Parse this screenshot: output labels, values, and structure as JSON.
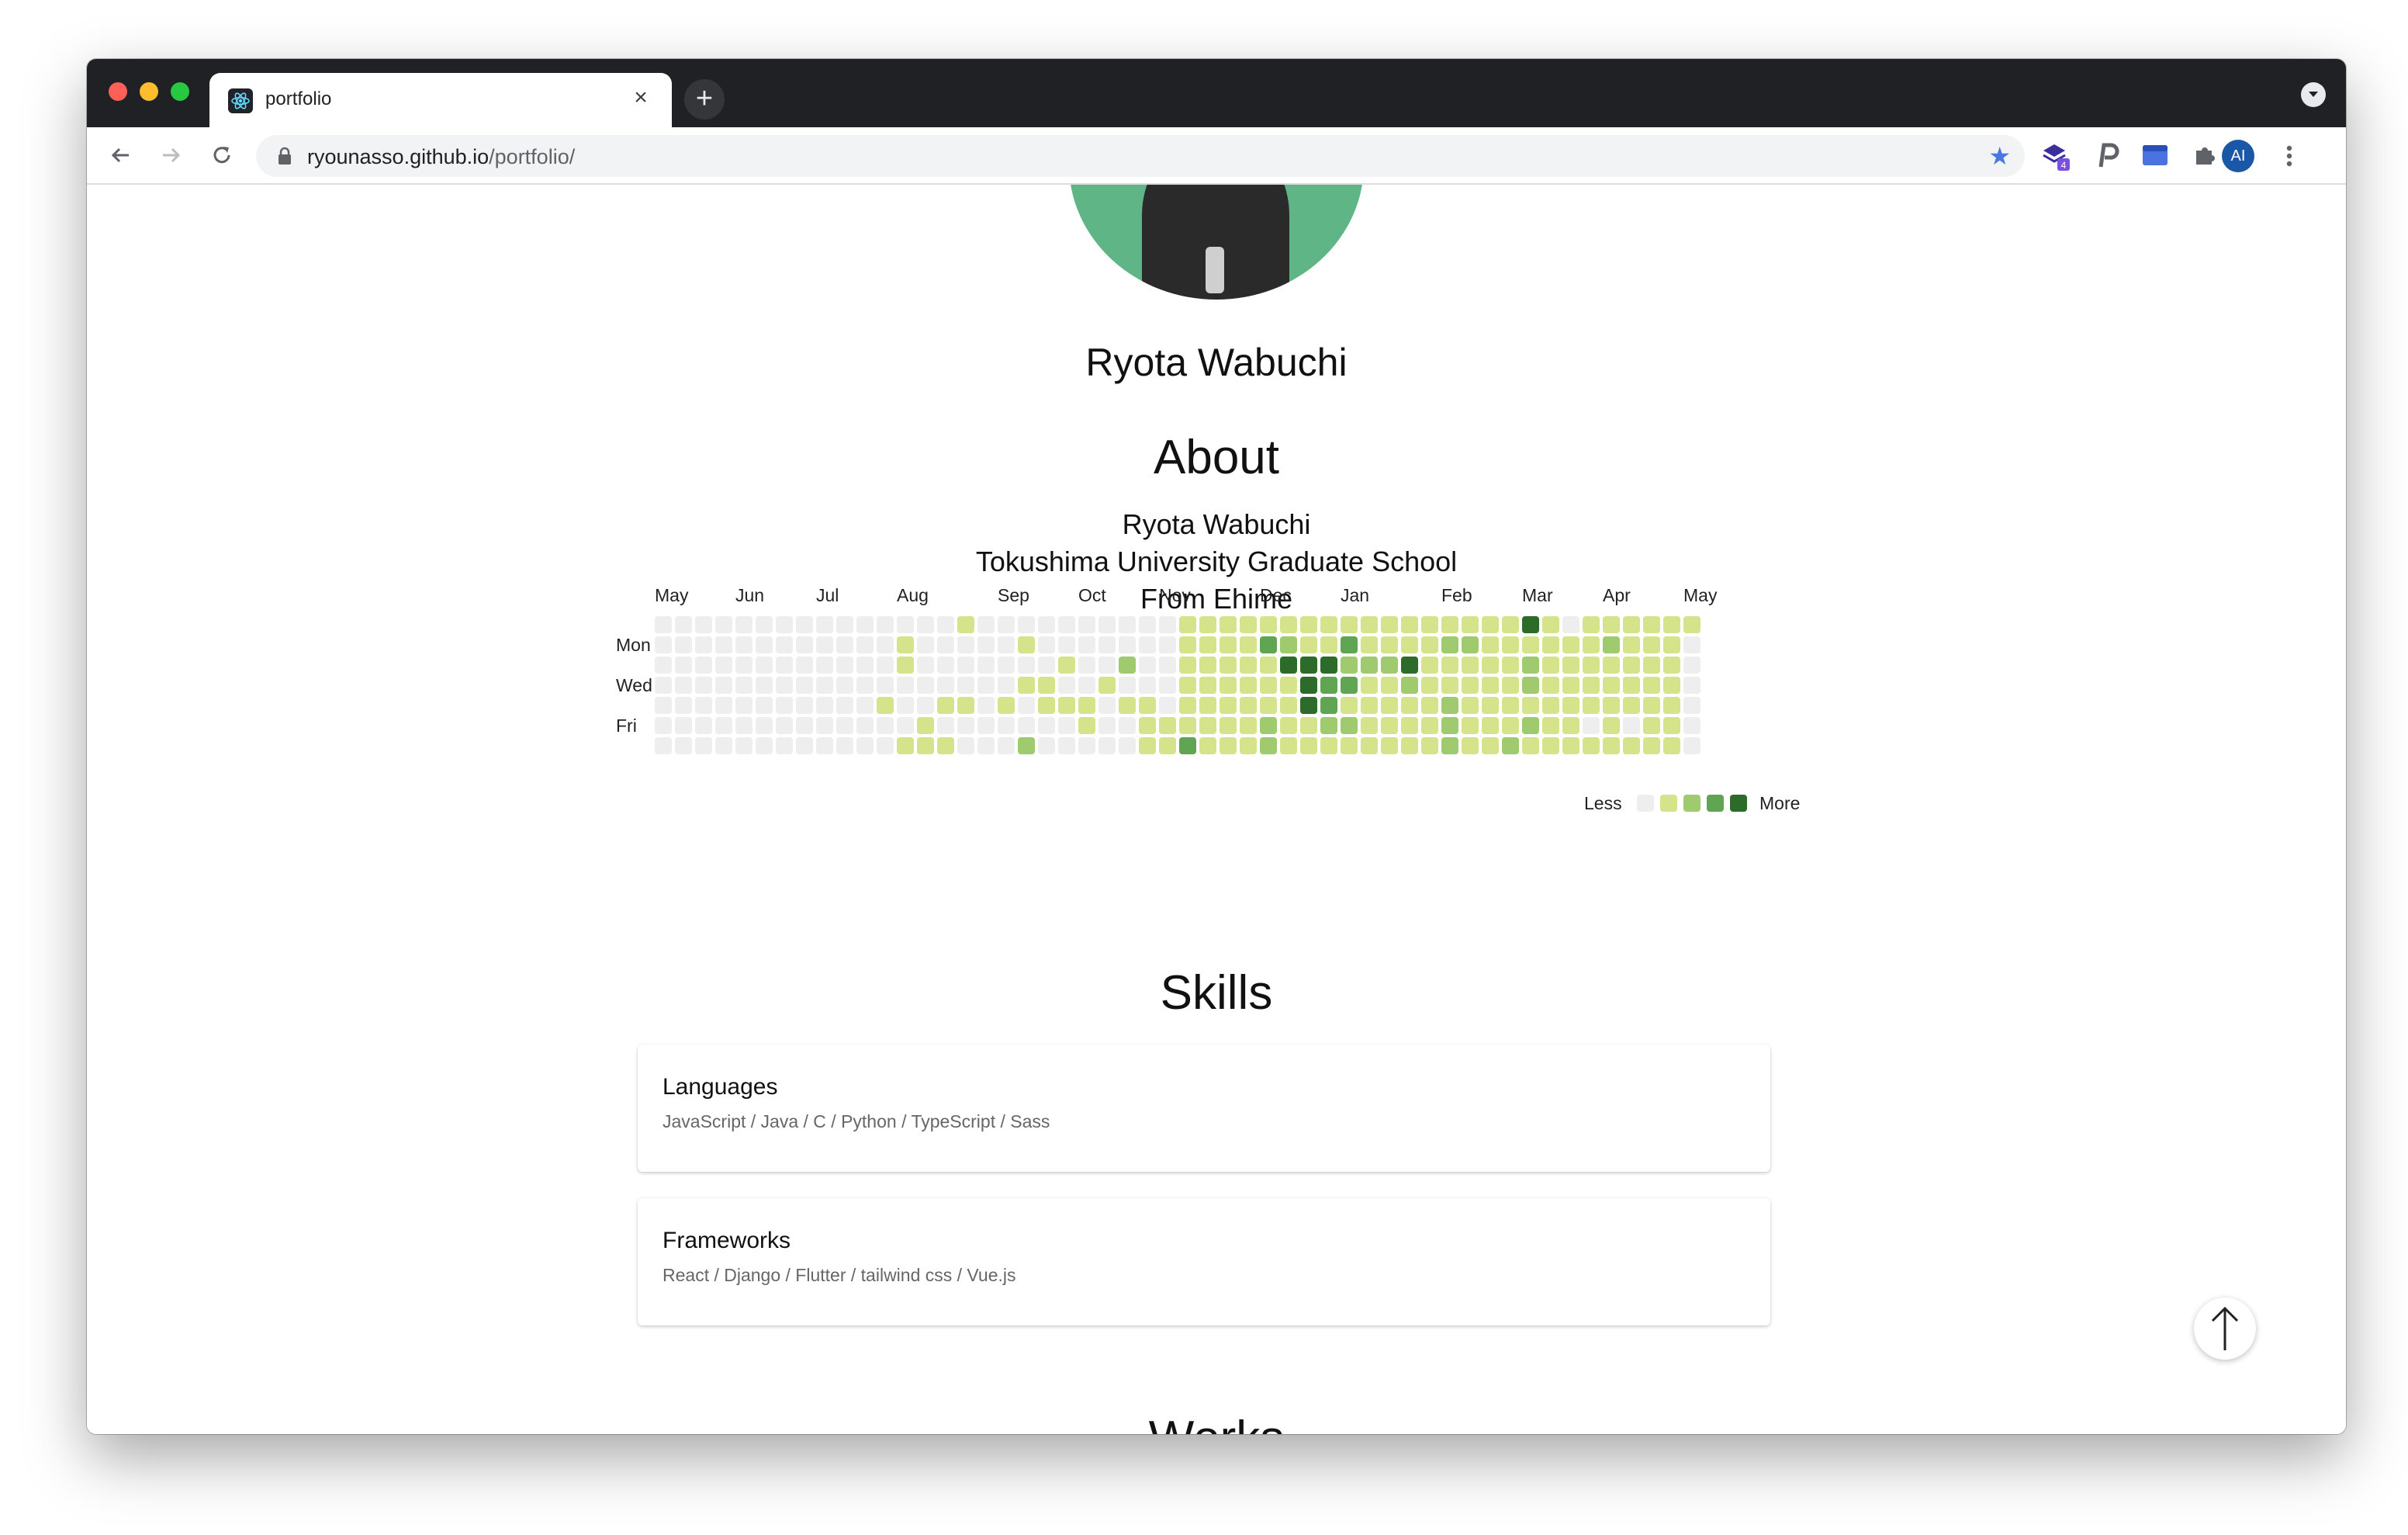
{
  "browser": {
    "tab_title": "portfolio",
    "url_host": "ryounasso.github.io",
    "url_path": "/portfolio/",
    "extension_badge": "4",
    "profile_initials": "AI"
  },
  "profile": {
    "name": "Ryota Wabuchi"
  },
  "about": {
    "title": "About",
    "lines": [
      "Ryota Wabuchi",
      "Tokushima University Graduate School",
      "From Ehime"
    ]
  },
  "contributions": {
    "months": [
      "May",
      "Jun",
      "Jul",
      "Aug",
      "Sep",
      "Oct",
      "Nov",
      "Dec",
      "Jan",
      "Feb",
      "Mar",
      "Apr",
      "May"
    ],
    "month_weeks": [
      0,
      4,
      8,
      12,
      17,
      21,
      25,
      30,
      34,
      39,
      43,
      47,
      51
    ],
    "day_labels": [
      "Mon",
      "Wed",
      "Fri"
    ],
    "day_label_rows": [
      1,
      3,
      5
    ],
    "legend_less": "Less",
    "legend_more": "More",
    "colors": [
      "#ebedf0",
      "#d6e685",
      "#8cc665",
      "#44a340",
      "#1e6823"
    ],
    "grid_colors": [
      "#eeeeee",
      "#d5e48a",
      "#9fcb6e",
      "#5fa552",
      "#2d6b2a"
    ],
    "weeks": [
      [
        0,
        0,
        0,
        0,
        0,
        0,
        0
      ],
      [
        0,
        0,
        0,
        0,
        0,
        0,
        0
      ],
      [
        0,
        0,
        0,
        0,
        0,
        0,
        0
      ],
      [
        0,
        0,
        0,
        0,
        0,
        0,
        0
      ],
      [
        0,
        0,
        0,
        0,
        0,
        0,
        0
      ],
      [
        0,
        0,
        0,
        0,
        0,
        0,
        0
      ],
      [
        0,
        0,
        0,
        0,
        0,
        0,
        0
      ],
      [
        0,
        0,
        0,
        0,
        0,
        0,
        0
      ],
      [
        0,
        0,
        0,
        0,
        0,
        0,
        0
      ],
      [
        0,
        0,
        0,
        0,
        0,
        0,
        0
      ],
      [
        0,
        0,
        0,
        0,
        0,
        0,
        0
      ],
      [
        0,
        0,
        0,
        0,
        1,
        0,
        0
      ],
      [
        0,
        1,
        1,
        0,
        0,
        0,
        1
      ],
      [
        0,
        0,
        0,
        0,
        0,
        1,
        1
      ],
      [
        0,
        0,
        0,
        0,
        1,
        0,
        1
      ],
      [
        1,
        0,
        0,
        0,
        1,
        0,
        0
      ],
      [
        0,
        0,
        0,
        0,
        0,
        0,
        0
      ],
      [
        0,
        0,
        0,
        0,
        1,
        0,
        0
      ],
      [
        0,
        1,
        0,
        1,
        0,
        0,
        2
      ],
      [
        0,
        0,
        0,
        1,
        1,
        0,
        0
      ],
      [
        0,
        0,
        1,
        0,
        1,
        0,
        0
      ],
      [
        0,
        0,
        0,
        0,
        1,
        1,
        0
      ],
      [
        0,
        0,
        0,
        1,
        0,
        0,
        0
      ],
      [
        0,
        0,
        2,
        0,
        1,
        0,
        0
      ],
      [
        0,
        0,
        0,
        0,
        1,
        1,
        1
      ],
      [
        0,
        0,
        0,
        0,
        0,
        1,
        1
      ],
      [
        1,
        1,
        1,
        1,
        1,
        1,
        3
      ],
      [
        1,
        1,
        1,
        1,
        1,
        1,
        1
      ],
      [
        1,
        1,
        1,
        1,
        1,
        1,
        1
      ],
      [
        1,
        1,
        1,
        1,
        1,
        1,
        1
      ],
      [
        1,
        3,
        1,
        1,
        1,
        2,
        2
      ],
      [
        1,
        2,
        4,
        1,
        1,
        1,
        1
      ],
      [
        1,
        1,
        4,
        4,
        4,
        1,
        1
      ],
      [
        1,
        1,
        4,
        3,
        3,
        2,
        1
      ],
      [
        1,
        3,
        2,
        3,
        1,
        2,
        1
      ],
      [
        1,
        1,
        2,
        1,
        1,
        1,
        1
      ],
      [
        1,
        1,
        2,
        1,
        1,
        1,
        1
      ],
      [
        1,
        1,
        4,
        2,
        1,
        1,
        1
      ],
      [
        1,
        1,
        1,
        1,
        1,
        1,
        1
      ],
      [
        1,
        2,
        1,
        1,
        2,
        2,
        2
      ],
      [
        1,
        2,
        1,
        1,
        1,
        1,
        1
      ],
      [
        1,
        1,
        1,
        1,
        1,
        1,
        1
      ],
      [
        1,
        1,
        1,
        1,
        1,
        1,
        2
      ],
      [
        4,
        1,
        2,
        2,
        1,
        2,
        1
      ],
      [
        1,
        1,
        1,
        1,
        1,
        1,
        1
      ],
      [
        0,
        1,
        1,
        1,
        1,
        1,
        1
      ],
      [
        1,
        1,
        1,
        1,
        1,
        0,
        1
      ],
      [
        1,
        2,
        1,
        1,
        1,
        1,
        1
      ],
      [
        1,
        1,
        1,
        1,
        1,
        0,
        1
      ],
      [
        1,
        1,
        1,
        1,
        1,
        1,
        1
      ],
      [
        1,
        1,
        1,
        1,
        1,
        1,
        1
      ],
      [
        1,
        0,
        0,
        0,
        0,
        0,
        0
      ]
    ]
  },
  "skills": {
    "title": "Skills",
    "cards": [
      {
        "title": "Languages",
        "items": "JavaScript / Java / C / Python / TypeScript / Sass"
      },
      {
        "title": "Frameworks",
        "items": "React / Django / Flutter / tailwind css / Vue.js"
      }
    ]
  },
  "works": {
    "title": "Works"
  }
}
